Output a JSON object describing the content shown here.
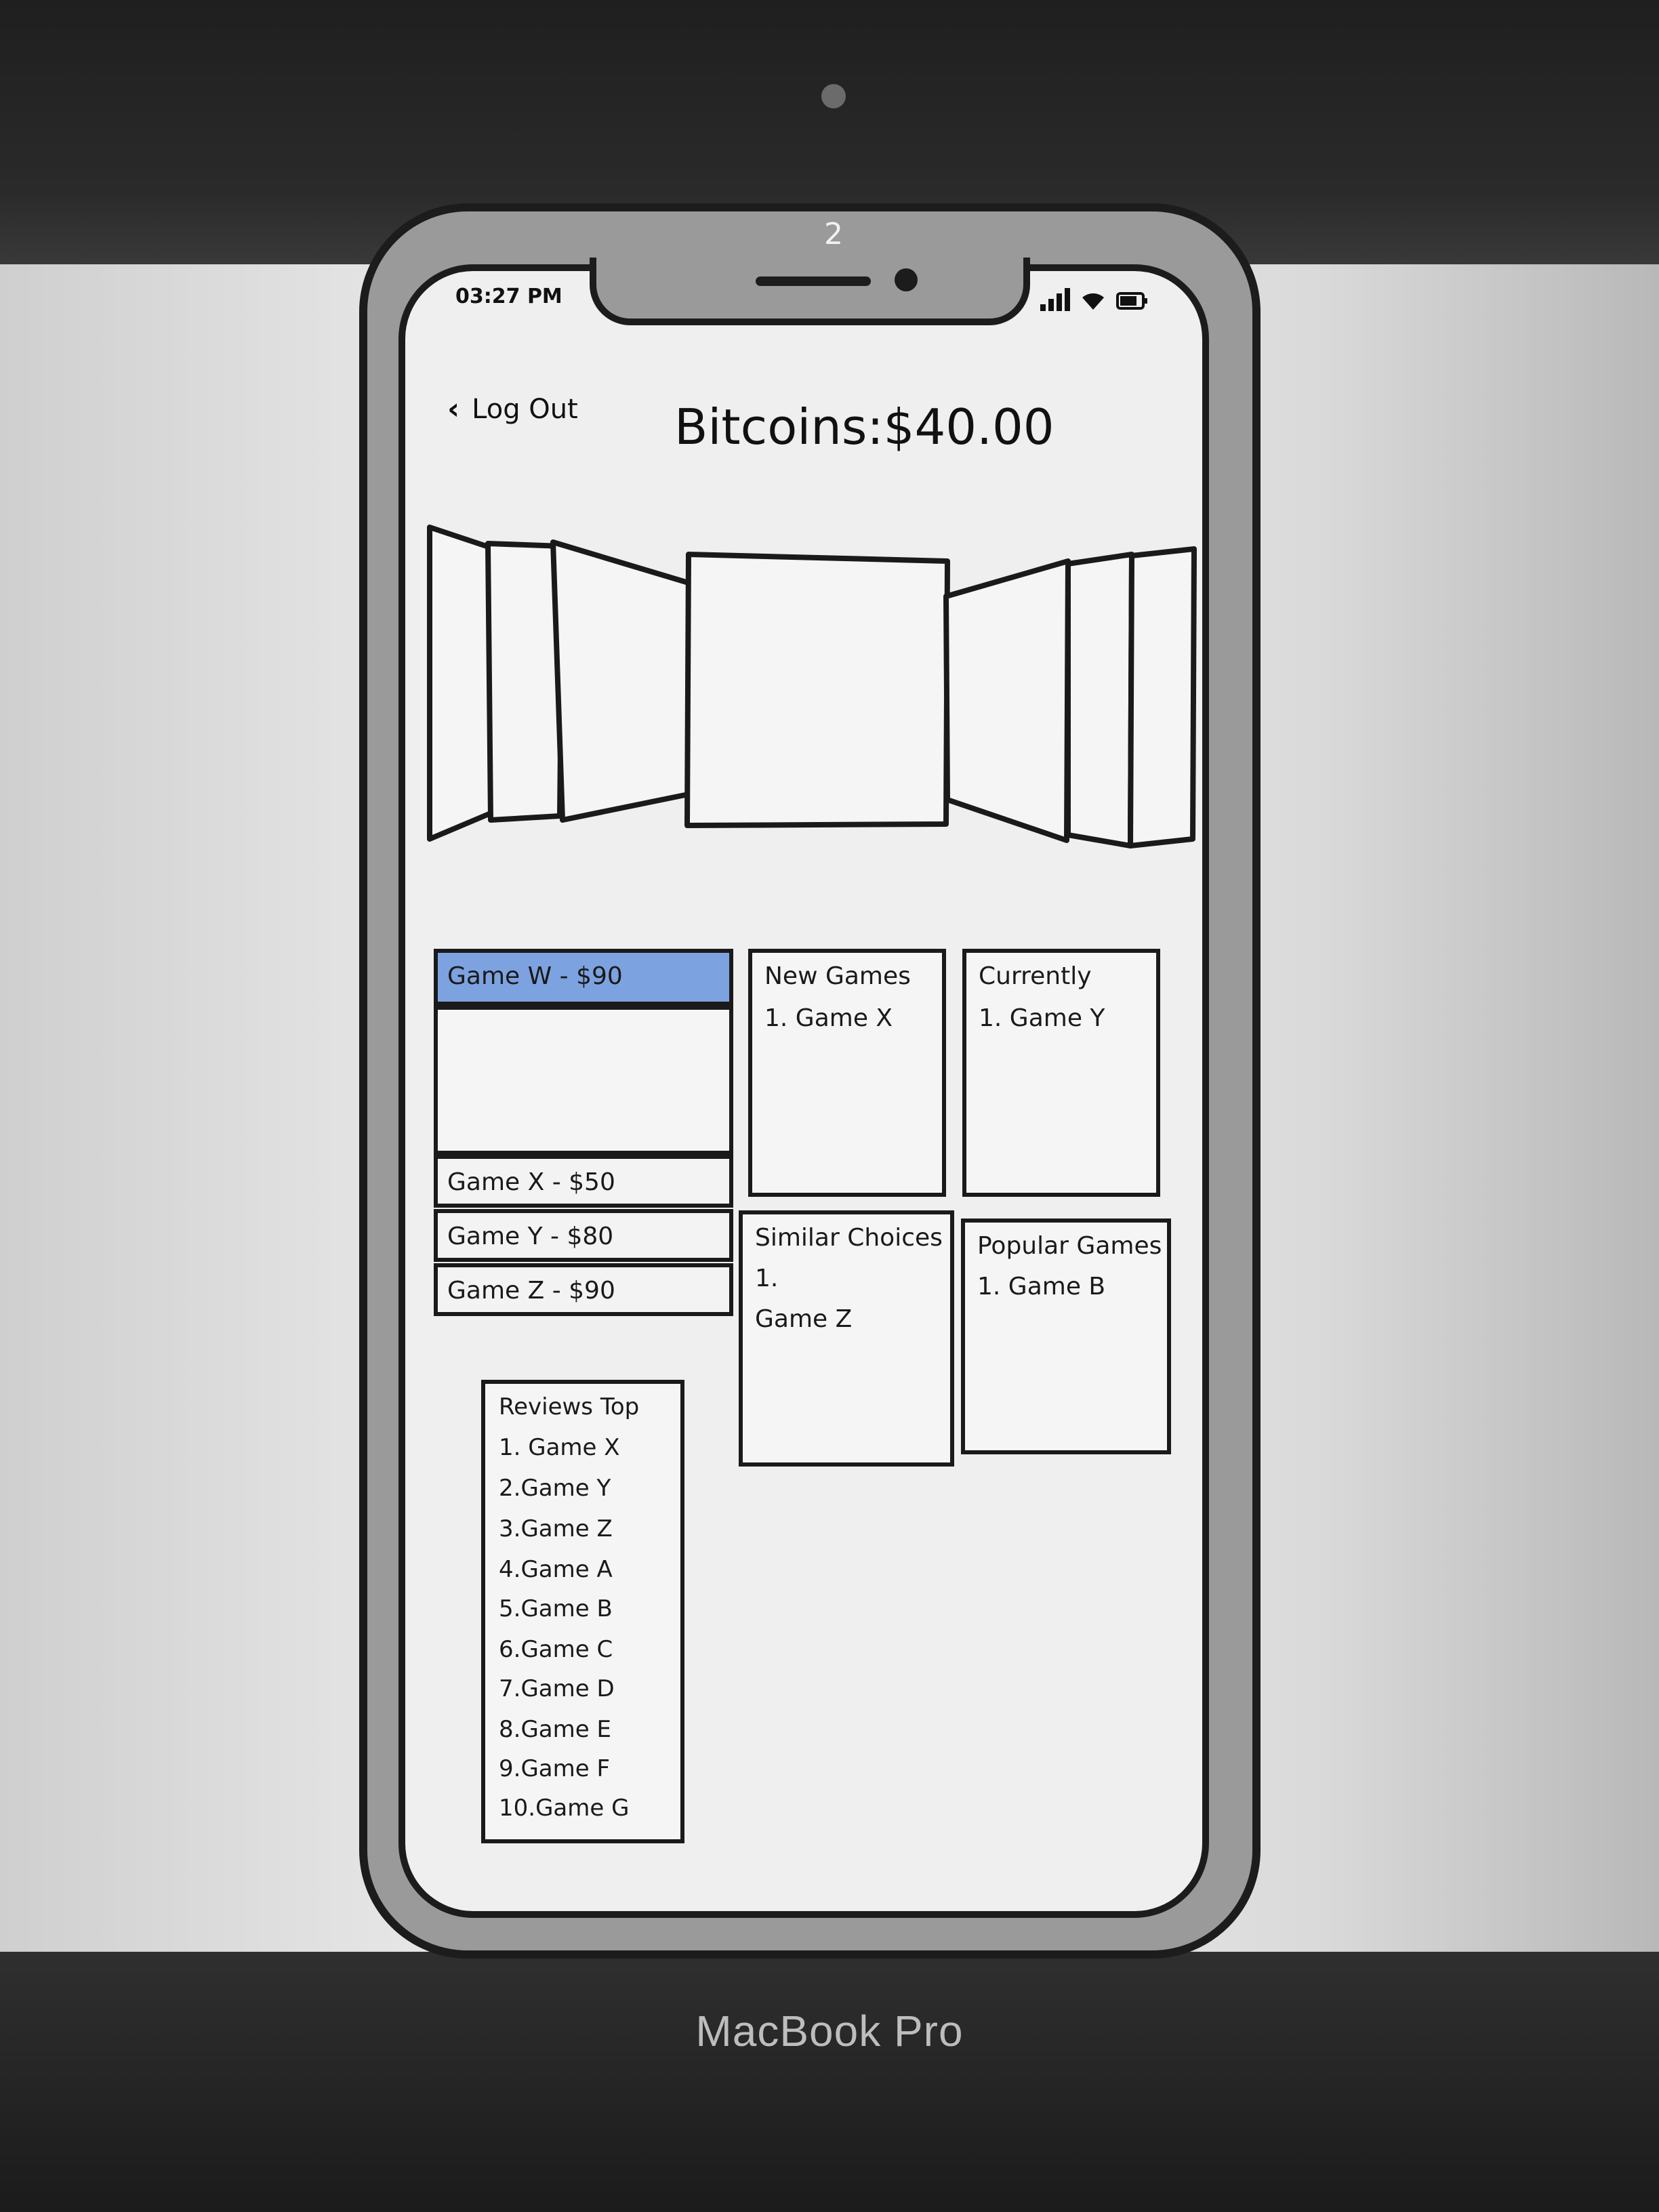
{
  "laptop": {
    "brand": "MacBook Pro",
    "page_number": "2"
  },
  "status_bar": {
    "time": "03:27 PM",
    "icons": [
      "signal-icon",
      "wifi-icon",
      "battery-icon"
    ]
  },
  "header": {
    "back_label": "Log Out",
    "back_icon": "chevron-left-icon",
    "balance": "Bitcoins:$40.00"
  },
  "game_list": {
    "selected": "Game W - $90",
    "items": [
      "Game X - $50",
      "Game Y - $80",
      "Game Z - $90"
    ]
  },
  "widgets": {
    "new_games": {
      "title": "New Games",
      "items": [
        "1. Game X"
      ]
    },
    "currently": {
      "title": "Currently",
      "items": [
        "1. Game Y"
      ]
    },
    "similar_choices": {
      "title": "Similar Choices",
      "items": [
        "1.",
        "Game Z"
      ]
    },
    "popular_games": {
      "title": "Popular Games",
      "items": [
        "1. Game B"
      ]
    },
    "reviews_top": {
      "title": "Reviews Top",
      "items": [
        "1. Game X",
        "2.Game Y",
        "3.Game Z",
        "4.Game A",
        "5.Game B",
        "6.Game C",
        "7.Game D",
        "8.Game E",
        "9.Game F",
        "10.Game G"
      ]
    }
  },
  "colors": {
    "selected_row": "#7da2e0",
    "ink": "#1a1a1a",
    "paper": "#efefef"
  }
}
